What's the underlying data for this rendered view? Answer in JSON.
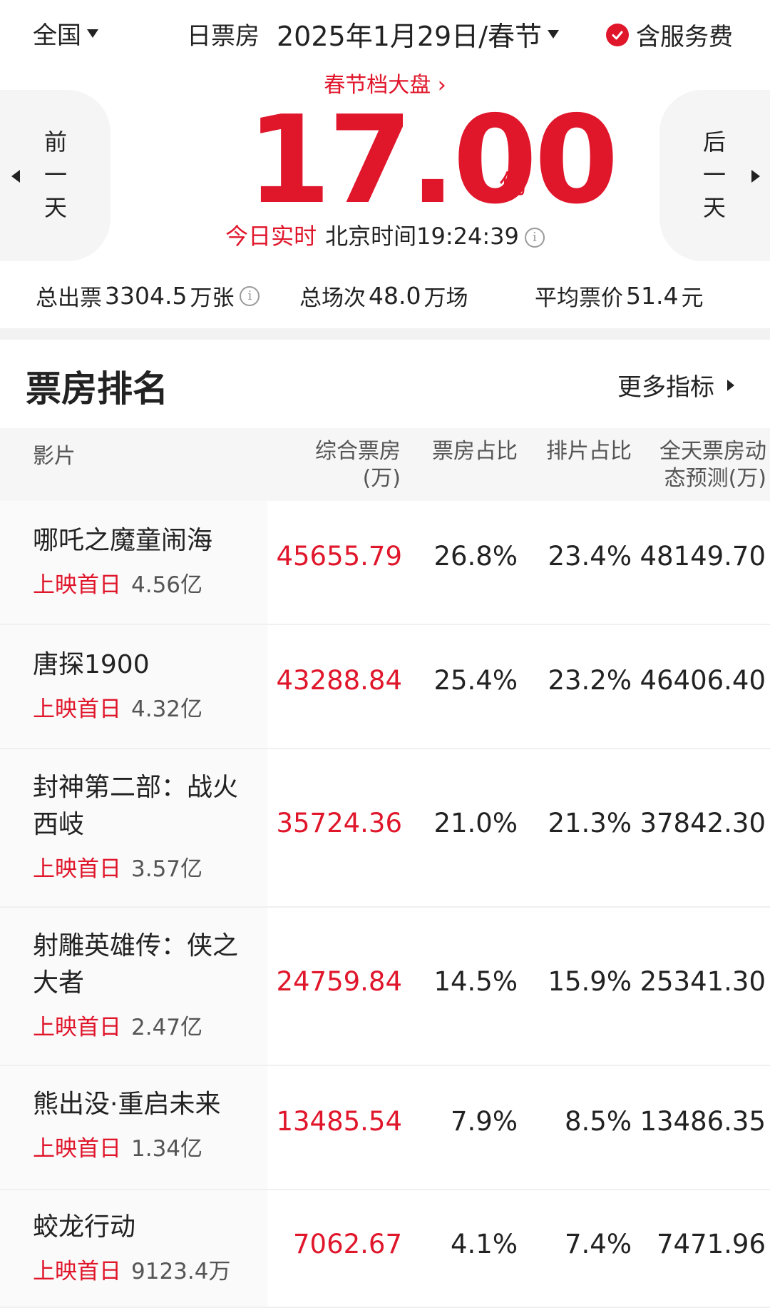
{
  "topbar": {
    "region": "全国",
    "date_label": "日票房",
    "date_value": "2025年1月29日/春节",
    "service_label": "含服务费"
  },
  "hero": {
    "market_link": "春节档大盘 ›",
    "total": "17.00",
    "total_unit": "亿",
    "realtime_label": "今日实时",
    "time_label": "北京时间",
    "time_value": "19:24:39",
    "prev_label": "前\n一\n天",
    "next_label": "后\n一\n天"
  },
  "stats": {
    "tickets_label": "总出票",
    "tickets_value": "3304.5",
    "tickets_unit": "万张",
    "shows_label": "总场次",
    "shows_value": "48.0",
    "shows_unit": "万场",
    "price_label": "平均票价",
    "price_value": "51.4",
    "price_unit": "元"
  },
  "ranking": {
    "title": "票房排名",
    "more_label": "更多指标",
    "columns": {
      "film": "影片",
      "boxoffice": "综合票房\n(万)",
      "share": "票房占比",
      "screening": "排片占比",
      "forecast": "全天票房动\n态预测(万)"
    },
    "rows": [
      {
        "name": "哪吒之魔童闹海",
        "tag": "上映首日",
        "tag_value": "4.56亿",
        "boxoffice": "45655.79",
        "share": "26.8%",
        "screening": "23.4%",
        "forecast": "48149.70"
      },
      {
        "name": "唐探1900",
        "tag": "上映首日",
        "tag_value": "4.32亿",
        "boxoffice": "43288.84",
        "share": "25.4%",
        "screening": "23.2%",
        "forecast": "46406.40"
      },
      {
        "name": "封神第二部：战火西岐",
        "tag": "上映首日",
        "tag_value": "3.57亿",
        "boxoffice": "35724.36",
        "share": "21.0%",
        "screening": "21.3%",
        "forecast": "37842.30"
      },
      {
        "name": "射雕英雄传：侠之大者",
        "tag": "上映首日",
        "tag_value": "2.47亿",
        "boxoffice": "24759.84",
        "share": "14.5%",
        "screening": "15.9%",
        "forecast": "25341.30"
      },
      {
        "name": "熊出没·重启未来",
        "tag": "上映首日",
        "tag_value": "1.34亿",
        "boxoffice": "13485.54",
        "share": "7.9%",
        "screening": "8.5%",
        "forecast": "13486.35"
      },
      {
        "name": "蛟龙行动",
        "tag": "上映首日",
        "tag_value": "9123.4万",
        "boxoffice": "7062.67",
        "share": "4.1%",
        "screening": "7.4%",
        "forecast": "7471.96"
      }
    ]
  },
  "colors": {
    "accent": "#e0162b",
    "text": "#222222",
    "muted": "#555555",
    "panel": "#f5f5f5"
  }
}
